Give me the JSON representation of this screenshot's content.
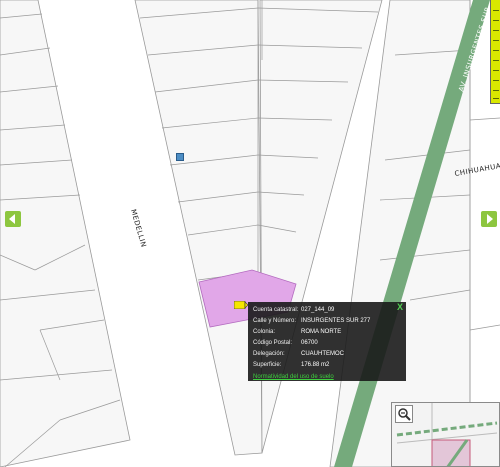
{
  "map": {
    "streets": {
      "medellin": "MEDELLIN",
      "insurgentes": "AV. INSURGENTES SUR",
      "chihuahua": "CHIHUAHUA"
    },
    "colors": {
      "parcel_highlight": "#e1a7e8",
      "avenue_green": "#75aa7c",
      "lot_line": "#9a9a9a",
      "nav_arrow": "#8dc63f",
      "zoom_slider": "#d9e800"
    },
    "icons": {
      "nav_left": "arrow-left-icon",
      "nav_right": "arrow-right-icon",
      "overview_zoom": "magnifier-icon",
      "marker": "location-marker-icon",
      "close": "close-icon"
    }
  },
  "popup": {
    "close": "X",
    "rows": [
      {
        "key": "Cuenta catastral:",
        "value": "027_144_09"
      },
      {
        "key": "Calle y Número:",
        "value": "INSURGENTES SUR 277"
      },
      {
        "key": "Colonia:",
        "value": "ROMA NORTE"
      },
      {
        "key": "Código Postal:",
        "value": "06700"
      },
      {
        "key": "Delegación:",
        "value": "CUAUHTEMOC"
      },
      {
        "key": "Superficie:",
        "value": "176.88 m2"
      }
    ],
    "link": "Normatividad del uso de suelo"
  }
}
